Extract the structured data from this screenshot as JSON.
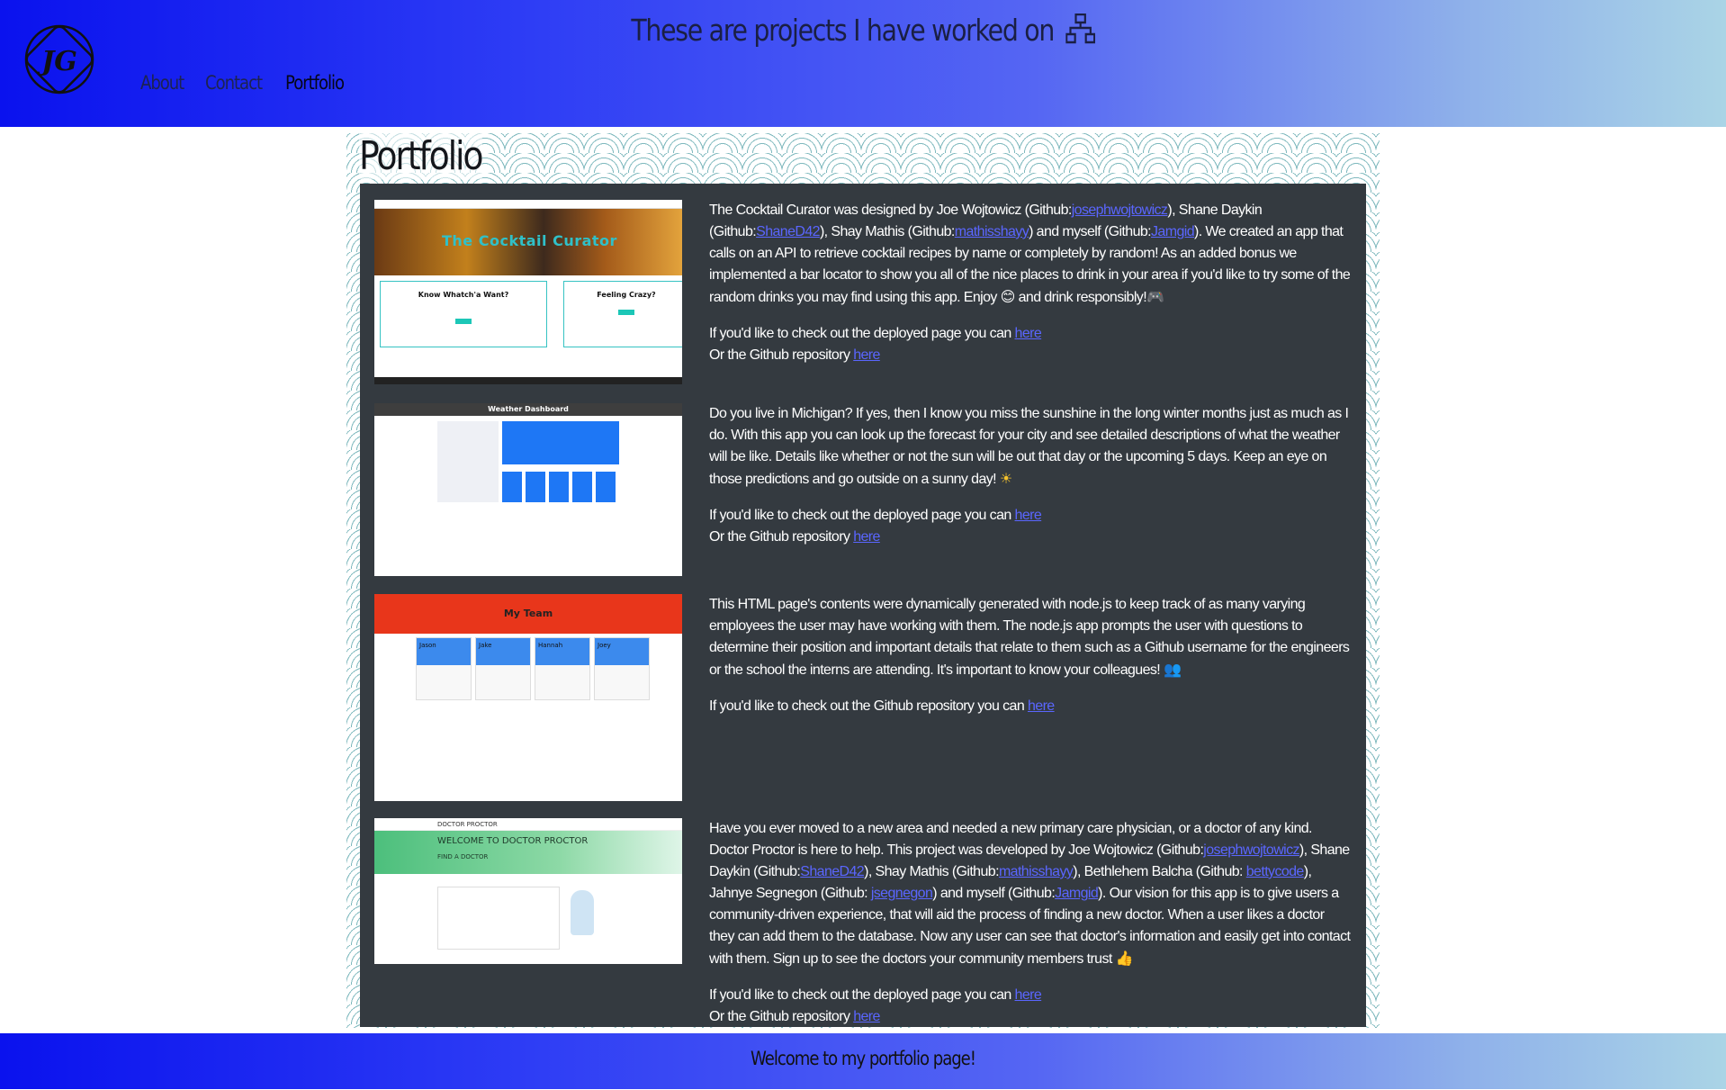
{
  "header": {
    "logo_text": "JG",
    "title": "These are projects I have worked on",
    "title_icon": "sitemap-icon",
    "nav": [
      {
        "label": "About"
      },
      {
        "label": "Contact"
      },
      {
        "label": "Portfolio"
      }
    ]
  },
  "portfolio": {
    "title": "Portfolio",
    "projects": [
      {
        "thumbnail": {
          "banner": "The Cocktail Curator",
          "box1": "Know Whatch'a Want?",
          "box2": "Feeling Crazy?"
        },
        "desc_parts": [
          "The Cocktail Curator was designed by Joe Wojtowicz (Github:",
          "josephwojtowicz",
          "), Shane Daykin (Github:",
          "ShaneD42",
          "), Shay Mathis (Github:",
          "mathisshayy",
          ") and myself (Github:",
          "Jamgid",
          "). We created an app that calls on an API to retrieve cocktail recipes by name or completely by random! As an added bonus we implemented a bar locator to show you all of the nice places to drink in your area if you'd like to try some of the random drinks you may find using this app. Enjoy ",
          "😊",
          " and drink responsibly!",
          "🎮"
        ],
        "deployed_text": "If you'd like to check out the deployed page you can",
        "deployed_link": "here",
        "repo_text": "Or the Github repository",
        "repo_link": "here"
      },
      {
        "thumbnail": {
          "banner": "Weather Dashboard"
        },
        "desc": "Do you live in Michigan? If yes, then I know you miss the sunshine in the long winter months just as much as I do. With this app you can look up the forecast for your city and see detailed descriptions of what the weather will be like. Details like whether or not the sun will be out that day or the upcoming 5 days. Keep an eye on those predictions and go outside on a sunny day!",
        "emoji": "☀",
        "deployed_text": "If you'd like to check out the deployed page you can",
        "deployed_link": "here",
        "repo_text": "Or the Github repository",
        "repo_link": "here"
      },
      {
        "thumbnail": {
          "banner": "My Team",
          "cards": [
            "Jason",
            "Jake",
            "Hannah",
            "Joey"
          ]
        },
        "desc": "This HTML page's contents were dynamically generated with node.js to keep track of as many varying employees the user may have working with them. The node.js app prompts the user with questions to determine their position and important details that relate to them such as a Github username for the engineers or the school the interns are attending. It's important to know your colleagues!",
        "emoji": "👥",
        "repo_text": "If you'd like to check out the Github repository you can",
        "repo_link": "here"
      },
      {
        "thumbnail": {
          "nav": "DOCTOR PROCTOR",
          "hero": "WELCOME TO DOCTOR PROCTOR",
          "hero_sub": "FIND A DOCTOR"
        },
        "desc_parts": [
          "Have you ever moved to a new area and needed a new primary care physician, or a doctor of any kind. Doctor Proctor is here to help. This project was developed by Joe Wojtowicz (Github:",
          "josephwojtowicz",
          "), Shane Daykin (Github:",
          "ShaneD42",
          "), Shay Mathis (Github:",
          "mathisshayy",
          "), Bethlehem Balcha (Github: ",
          "bettycode",
          "), Jahnye Segnegon (Github: ",
          "jsegnegon",
          ") and myself (Github:",
          "Jamgid",
          "). Our vision for this app is to give users a community-driven experience, that will aid the process of finding a new doctor. When a user likes a doctor they can add them to the database. Now any user can see that doctor's information and easily get into contact with them. Sign up to see the doctors your community members trust",
          "👍"
        ],
        "deployed_text": "If you'd like to check out the deployed page you can",
        "deployed_link": "here",
        "repo_text": "Or the Github repository",
        "repo_link": "here"
      }
    ]
  },
  "footer": {
    "text": "Welcome to my portfolio page!"
  },
  "colors": {
    "link": "#5a66ff",
    "panel": "#343a40",
    "gradient_start": "#0a12ee",
    "gradient_end": "#aad4e6"
  }
}
